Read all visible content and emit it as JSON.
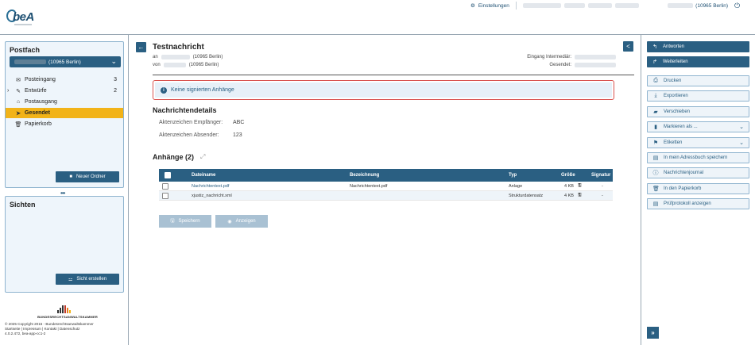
{
  "app": {
    "logo_text": "beA"
  },
  "topbar": {
    "settings_label": "Einstellungen",
    "user_label": "(10965 Berlin)"
  },
  "sidebar": {
    "postfach_title": "Postfach",
    "postfach_selected": "(10965 Berlin)",
    "items": [
      {
        "label": "Posteingang",
        "count": "3",
        "icon": "inbox-icon"
      },
      {
        "label": "Entwürfe",
        "count": "2",
        "icon": "edit-icon"
      },
      {
        "label": "Postausgang",
        "count": "",
        "icon": "outbox-icon"
      },
      {
        "label": "Gesendet",
        "count": "",
        "icon": "send-icon"
      },
      {
        "label": "Papierkorb",
        "count": "",
        "icon": "trash-icon"
      }
    ],
    "new_folder_label": "Neuer Ordner",
    "views_title": "Sichten",
    "create_view_label": "Sicht erstellen",
    "brak_name": "BUNDESRECHTSANWALTSKAMMER",
    "footer_lines": [
      "© 2025 Copyright 2015 - Bundesrechtsanwaltskammer",
      "Startseite | Impressum | Kontakt | Datenschutz",
      "4.0.2.472, bea-app-cc1-2"
    ]
  },
  "message": {
    "title": "Testnachricht",
    "an_label": "an",
    "an_value": "(10965 Berlin)",
    "von_label": "von",
    "von_value": "(10965 Berlin)",
    "eingang_label": "Eingang Intermediär:",
    "gesendet_label": "Gesendet:",
    "alert_text": "Keine signierten Anhänge",
    "details_title": "Nachrichtendetails",
    "details": [
      {
        "label": "Aktenzeichen Empfänger:",
        "value": "ABC"
      },
      {
        "label": "Aktenzeichen Absender:",
        "value": "123"
      }
    ],
    "attachments_title": "Anhänge (2)"
  },
  "table": {
    "headers": [
      "Dateiname",
      "Bezeichnung",
      "Typ",
      "Größe",
      "Signatur"
    ],
    "rows": [
      {
        "dateiname": "Nachrichtentext.pdf",
        "bezeichnung": "Nachrichtentext.pdf",
        "typ": "Anlage",
        "groesse": "4 KB",
        "signatur": "-"
      },
      {
        "dateiname": "xjustiz_nachricht.xml",
        "bezeichnung": "",
        "typ": "Strukturdatensatz",
        "groesse": "4 KB",
        "signatur": "-"
      }
    ]
  },
  "actions": {
    "save_label": "Speichern",
    "show_label": "Anzeigen"
  },
  "right_panel": {
    "buttons": [
      {
        "label": "Antworten",
        "style": "primary",
        "icon": "reply-icon"
      },
      {
        "label": "Weiterleiten",
        "style": "primary",
        "icon": "forward-icon"
      },
      {
        "label": "Drucken",
        "style": "secondary",
        "icon": "print-icon"
      },
      {
        "label": "Exportieren",
        "style": "secondary",
        "icon": "download-icon"
      },
      {
        "label": "Verschieben",
        "style": "secondary",
        "icon": "folder-move-icon"
      },
      {
        "label": "Markieren als ...",
        "style": "secondary",
        "icon": "bookmark-icon"
      },
      {
        "label": "Etiketten",
        "style": "secondary",
        "icon": "tags-icon"
      },
      {
        "label": "In mein Adressbuch speichern",
        "style": "secondary",
        "icon": "address-book-icon"
      },
      {
        "label": "Nachrichtenjournal",
        "style": "secondary",
        "icon": "info-icon"
      },
      {
        "label": "In den Papierkorb",
        "style": "secondary",
        "icon": "trash-icon"
      },
      {
        "label": "Prüfprotokoll anzeigen",
        "style": "secondary",
        "icon": "document-icon"
      }
    ]
  },
  "colors": {
    "primary": "#2a5f82",
    "active_nav": "#f2b318",
    "alert_border": "#d9534f",
    "panel_bg": "#eef5fb"
  }
}
